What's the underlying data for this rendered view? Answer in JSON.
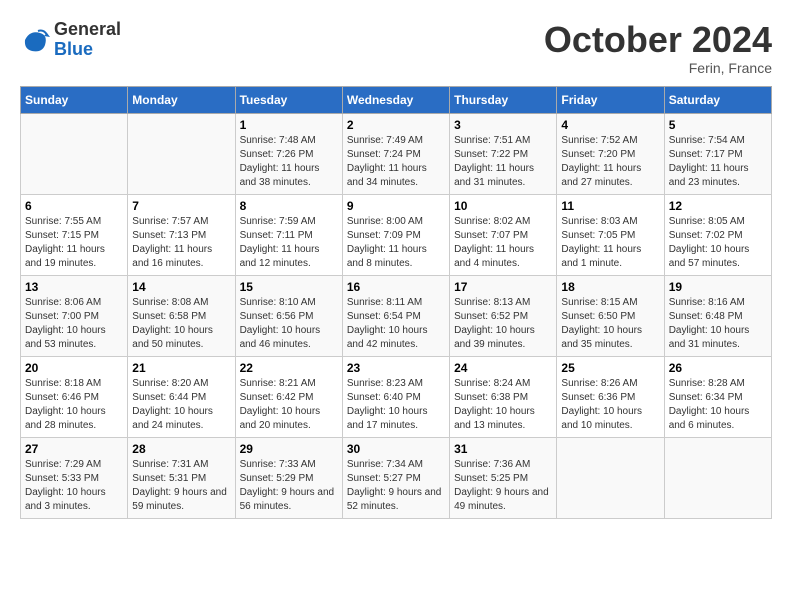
{
  "logo": {
    "general": "General",
    "blue": "Blue"
  },
  "title": {
    "month_year": "October 2024",
    "location": "Ferin, France"
  },
  "headers": [
    "Sunday",
    "Monday",
    "Tuesday",
    "Wednesday",
    "Thursday",
    "Friday",
    "Saturday"
  ],
  "weeks": [
    [
      {
        "day": "",
        "info": ""
      },
      {
        "day": "",
        "info": ""
      },
      {
        "day": "1",
        "info": "Sunrise: 7:48 AM\nSunset: 7:26 PM\nDaylight: 11 hours and 38 minutes."
      },
      {
        "day": "2",
        "info": "Sunrise: 7:49 AM\nSunset: 7:24 PM\nDaylight: 11 hours and 34 minutes."
      },
      {
        "day": "3",
        "info": "Sunrise: 7:51 AM\nSunset: 7:22 PM\nDaylight: 11 hours and 31 minutes."
      },
      {
        "day": "4",
        "info": "Sunrise: 7:52 AM\nSunset: 7:20 PM\nDaylight: 11 hours and 27 minutes."
      },
      {
        "day": "5",
        "info": "Sunrise: 7:54 AM\nSunset: 7:17 PM\nDaylight: 11 hours and 23 minutes."
      }
    ],
    [
      {
        "day": "6",
        "info": "Sunrise: 7:55 AM\nSunset: 7:15 PM\nDaylight: 11 hours and 19 minutes."
      },
      {
        "day": "7",
        "info": "Sunrise: 7:57 AM\nSunset: 7:13 PM\nDaylight: 11 hours and 16 minutes."
      },
      {
        "day": "8",
        "info": "Sunrise: 7:59 AM\nSunset: 7:11 PM\nDaylight: 11 hours and 12 minutes."
      },
      {
        "day": "9",
        "info": "Sunrise: 8:00 AM\nSunset: 7:09 PM\nDaylight: 11 hours and 8 minutes."
      },
      {
        "day": "10",
        "info": "Sunrise: 8:02 AM\nSunset: 7:07 PM\nDaylight: 11 hours and 4 minutes."
      },
      {
        "day": "11",
        "info": "Sunrise: 8:03 AM\nSunset: 7:05 PM\nDaylight: 11 hours and 1 minute."
      },
      {
        "day": "12",
        "info": "Sunrise: 8:05 AM\nSunset: 7:02 PM\nDaylight: 10 hours and 57 minutes."
      }
    ],
    [
      {
        "day": "13",
        "info": "Sunrise: 8:06 AM\nSunset: 7:00 PM\nDaylight: 10 hours and 53 minutes."
      },
      {
        "day": "14",
        "info": "Sunrise: 8:08 AM\nSunset: 6:58 PM\nDaylight: 10 hours and 50 minutes."
      },
      {
        "day": "15",
        "info": "Sunrise: 8:10 AM\nSunset: 6:56 PM\nDaylight: 10 hours and 46 minutes."
      },
      {
        "day": "16",
        "info": "Sunrise: 8:11 AM\nSunset: 6:54 PM\nDaylight: 10 hours and 42 minutes."
      },
      {
        "day": "17",
        "info": "Sunrise: 8:13 AM\nSunset: 6:52 PM\nDaylight: 10 hours and 39 minutes."
      },
      {
        "day": "18",
        "info": "Sunrise: 8:15 AM\nSunset: 6:50 PM\nDaylight: 10 hours and 35 minutes."
      },
      {
        "day": "19",
        "info": "Sunrise: 8:16 AM\nSunset: 6:48 PM\nDaylight: 10 hours and 31 minutes."
      }
    ],
    [
      {
        "day": "20",
        "info": "Sunrise: 8:18 AM\nSunset: 6:46 PM\nDaylight: 10 hours and 28 minutes."
      },
      {
        "day": "21",
        "info": "Sunrise: 8:20 AM\nSunset: 6:44 PM\nDaylight: 10 hours and 24 minutes."
      },
      {
        "day": "22",
        "info": "Sunrise: 8:21 AM\nSunset: 6:42 PM\nDaylight: 10 hours and 20 minutes."
      },
      {
        "day": "23",
        "info": "Sunrise: 8:23 AM\nSunset: 6:40 PM\nDaylight: 10 hours and 17 minutes."
      },
      {
        "day": "24",
        "info": "Sunrise: 8:24 AM\nSunset: 6:38 PM\nDaylight: 10 hours and 13 minutes."
      },
      {
        "day": "25",
        "info": "Sunrise: 8:26 AM\nSunset: 6:36 PM\nDaylight: 10 hours and 10 minutes."
      },
      {
        "day": "26",
        "info": "Sunrise: 8:28 AM\nSunset: 6:34 PM\nDaylight: 10 hours and 6 minutes."
      }
    ],
    [
      {
        "day": "27",
        "info": "Sunrise: 7:29 AM\nSunset: 5:33 PM\nDaylight: 10 hours and 3 minutes."
      },
      {
        "day": "28",
        "info": "Sunrise: 7:31 AM\nSunset: 5:31 PM\nDaylight: 9 hours and 59 minutes."
      },
      {
        "day": "29",
        "info": "Sunrise: 7:33 AM\nSunset: 5:29 PM\nDaylight: 9 hours and 56 minutes."
      },
      {
        "day": "30",
        "info": "Sunrise: 7:34 AM\nSunset: 5:27 PM\nDaylight: 9 hours and 52 minutes."
      },
      {
        "day": "31",
        "info": "Sunrise: 7:36 AM\nSunset: 5:25 PM\nDaylight: 9 hours and 49 minutes."
      },
      {
        "day": "",
        "info": ""
      },
      {
        "day": "",
        "info": ""
      }
    ]
  ]
}
